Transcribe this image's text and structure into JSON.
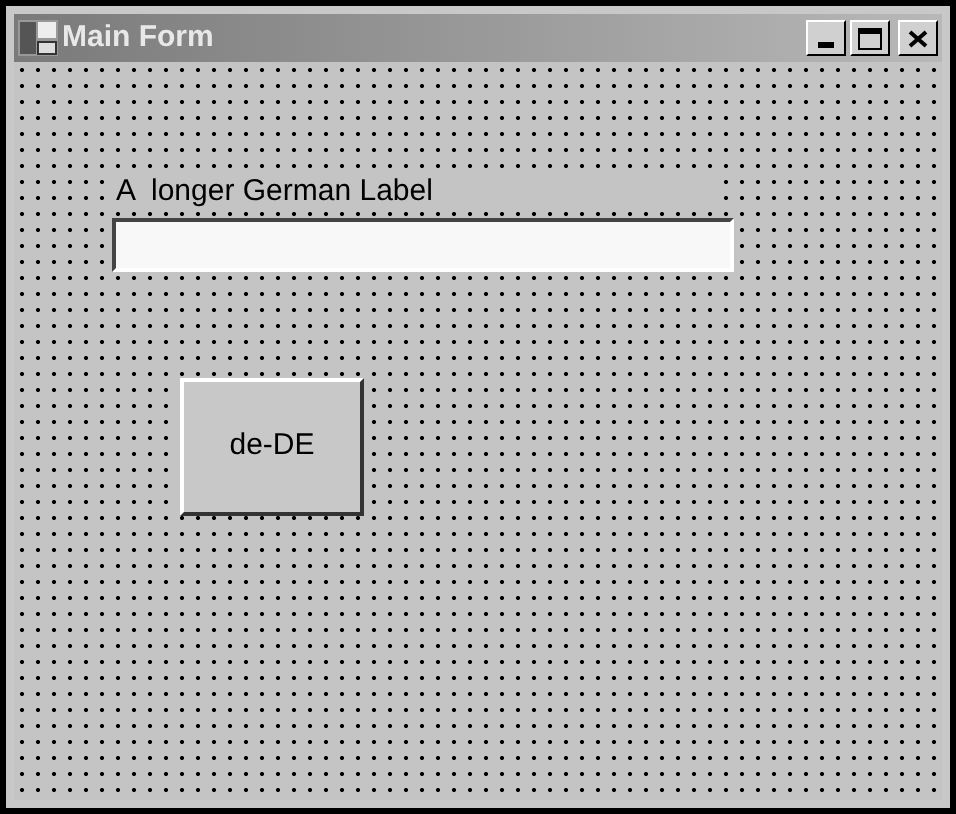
{
  "window": {
    "title": "Main Form"
  },
  "label": "A  longer German Label",
  "button": {
    "label": "de-DE"
  }
}
